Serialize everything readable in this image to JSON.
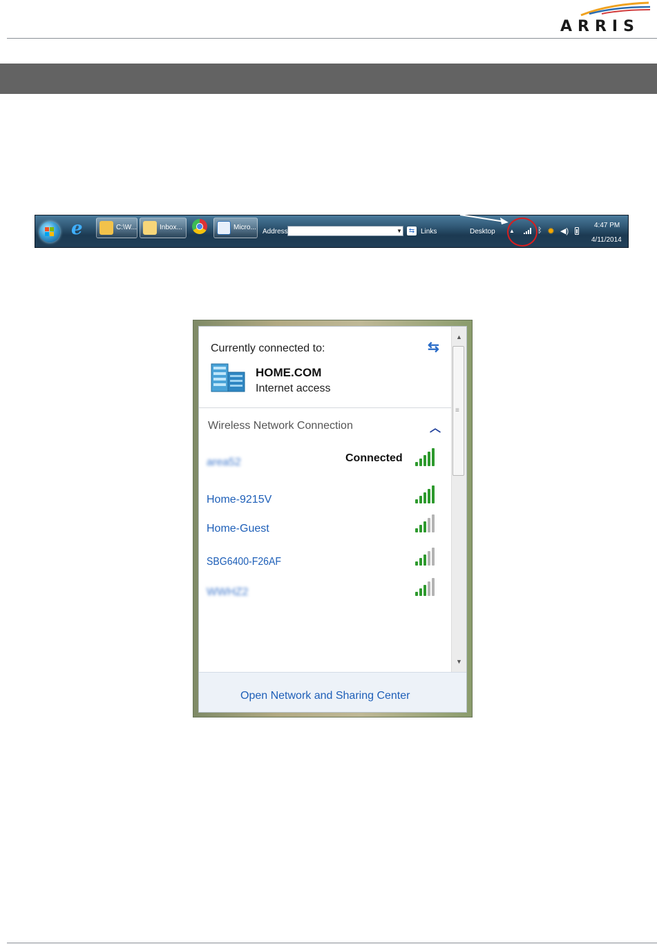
{
  "brand": {
    "logo_text": "ARRIS"
  },
  "taskbar": {
    "tasks": [
      {
        "label": "C:\\W...",
        "icon": "folder-icon"
      },
      {
        "label": "Inbox...",
        "icon": "mail-icon"
      },
      {
        "label": "Micro...",
        "icon": "lync-icon"
      }
    ],
    "address_label": "Address",
    "address_value": "",
    "links_label": "Links",
    "desktop_label": "Desktop",
    "clock_time": "4:47 PM",
    "clock_date": "4/11/2014"
  },
  "popup": {
    "currently_connected_label": "Currently connected to:",
    "network_name": "HOME.COM",
    "network_status": "Internet access",
    "wireless_header": "Wireless Network Connection",
    "networks": [
      {
        "ssid": "area52",
        "status": "Connected",
        "blurred": true,
        "strength": 5
      },
      {
        "ssid": "Home-9215V",
        "status": "",
        "blurred": false,
        "strength": 5
      },
      {
        "ssid": "Home-Guest",
        "status": "",
        "blurred": false,
        "strength": 3
      },
      {
        "ssid": "SBG6400-F26AF",
        "status": "",
        "blurred": false,
        "strength": 3
      },
      {
        "ssid": "WWHZ2",
        "status": "",
        "blurred": true,
        "strength": 3
      }
    ],
    "footer_link": "Open Network and Sharing Center"
  },
  "colors": {
    "section_bar": "#636363",
    "link_blue": "#1e5fb8",
    "signal_green": "#2e9a2e",
    "signal_gray": "#b4b4b4",
    "highlight_red": "#d81e1e"
  }
}
